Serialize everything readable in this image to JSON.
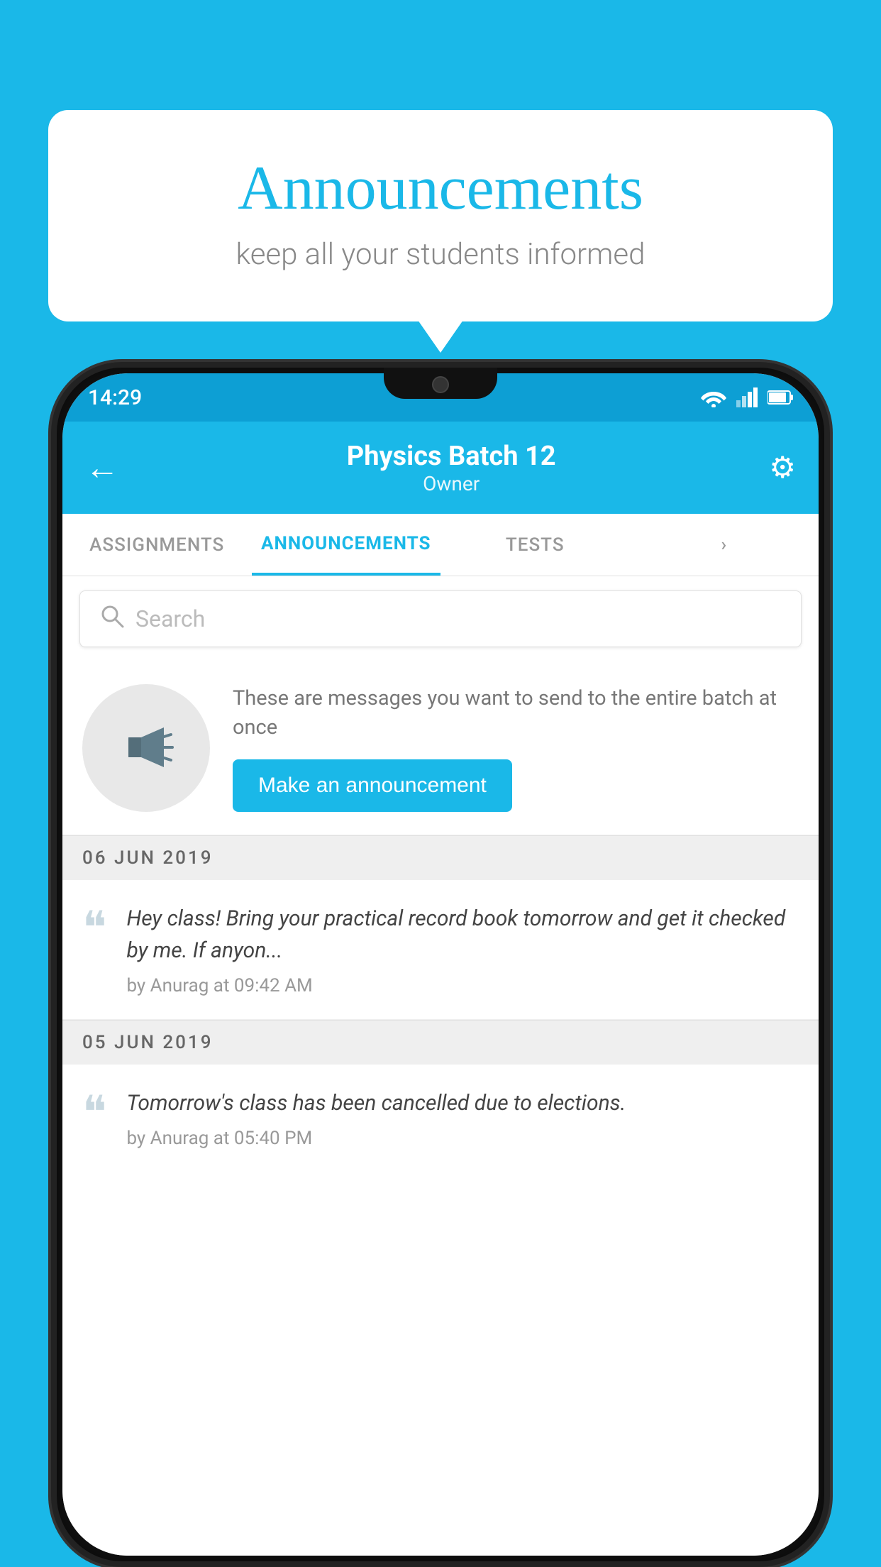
{
  "page": {
    "background_color": "#1ab8e8"
  },
  "speech_bubble": {
    "title": "Announcements",
    "subtitle": "keep all your students informed"
  },
  "status_bar": {
    "time": "14:29"
  },
  "header": {
    "title": "Physics Batch 12",
    "subtitle": "Owner",
    "back_label": "←",
    "gear_label": "⚙"
  },
  "tabs": [
    {
      "label": "ASSIGNMENTS",
      "active": false
    },
    {
      "label": "ANNOUNCEMENTS",
      "active": true
    },
    {
      "label": "TESTS",
      "active": false
    },
    {
      "label": "›",
      "active": false
    }
  ],
  "search": {
    "placeholder": "Search"
  },
  "promo": {
    "text": "These are messages you want to send to the entire batch at once",
    "button_label": "Make an announcement"
  },
  "announcements": [
    {
      "date": "06  JUN  2019",
      "text": "Hey class! Bring your practical record book tomorrow and get it checked by me. If anyon...",
      "meta": "by Anurag at 09:42 AM"
    },
    {
      "date": "05  JUN  2019",
      "text": "Tomorrow's class has been cancelled due to elections.",
      "meta": "by Anurag at 05:40 PM"
    }
  ]
}
